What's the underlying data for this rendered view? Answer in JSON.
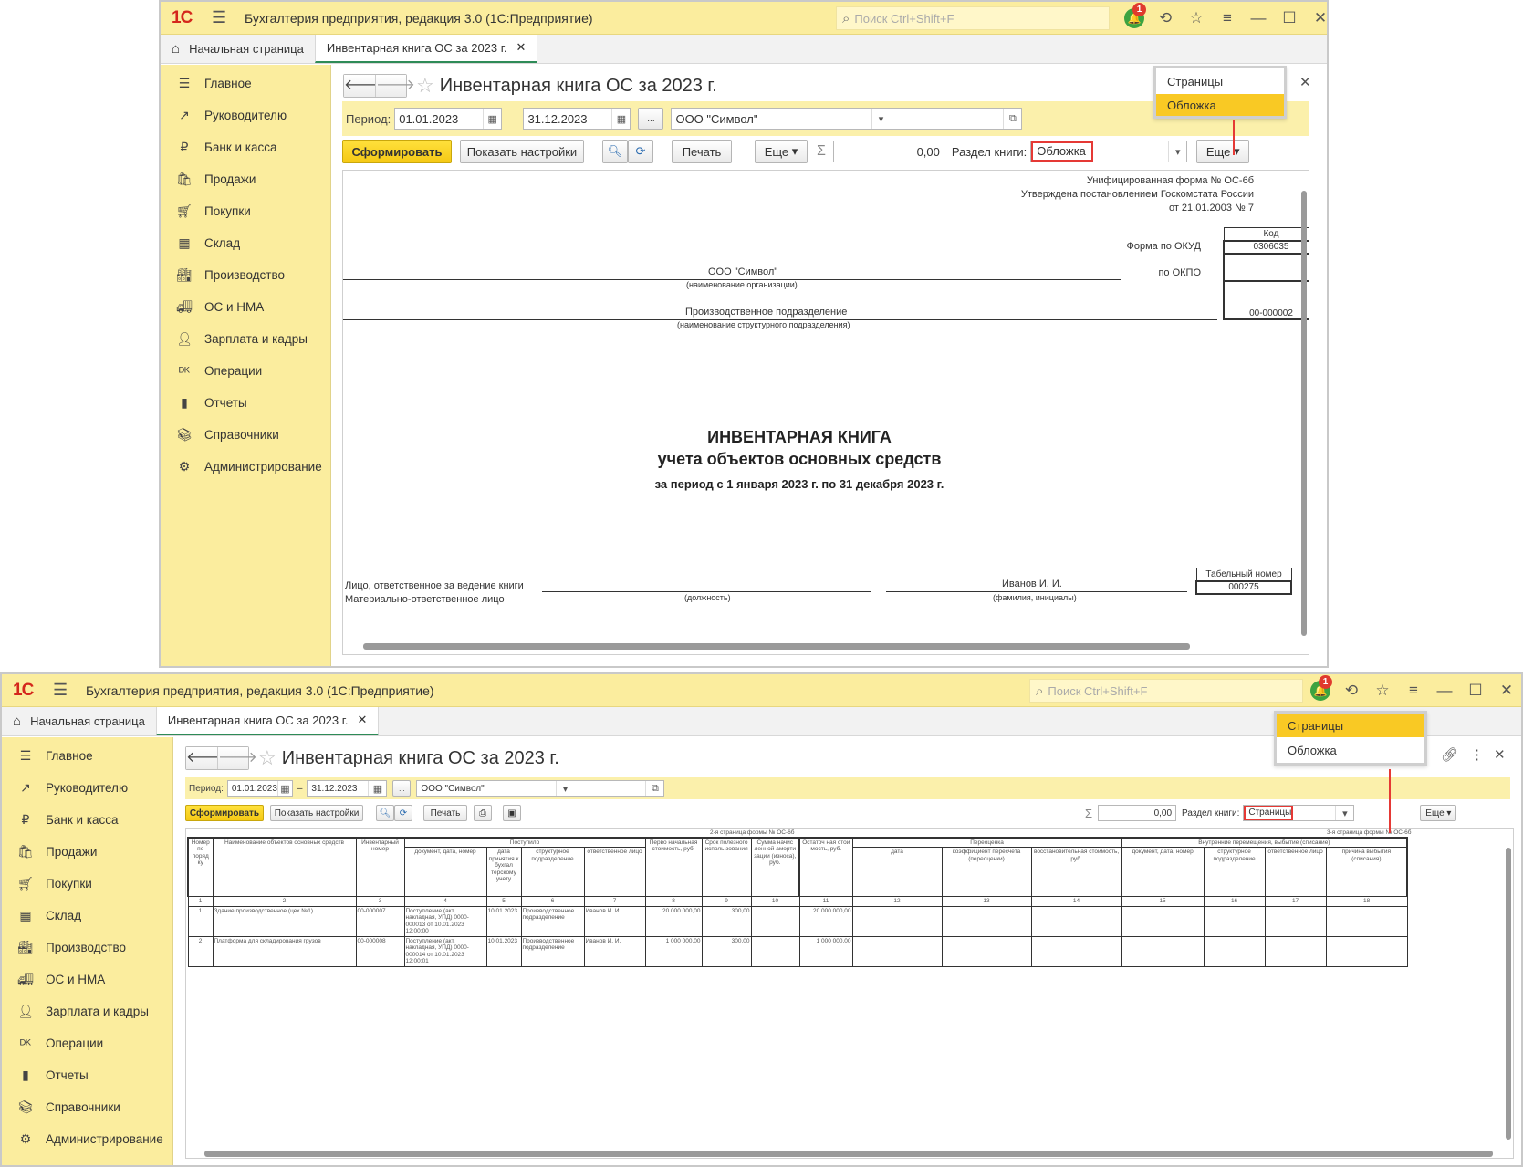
{
  "app": {
    "title": "Бухгалтерия предприятия, редакция 3.0  (1С:Предприятие)",
    "logo": "1С",
    "search_placeholder": "Поиск Ctrl+Shift+F",
    "notifications": "1"
  },
  "tabs": {
    "home": "Начальная страница",
    "active": "Инвентарная книга ОС за 2023 г."
  },
  "sidebar": {
    "items": [
      {
        "label": "Главное",
        "icon": "menu-lines-icon"
      },
      {
        "label": "Руководителю",
        "icon": "trend-icon"
      },
      {
        "label": "Банк и касса",
        "icon": "ruble-coin-icon"
      },
      {
        "label": "Продажи",
        "icon": "bag-icon"
      },
      {
        "label": "Покупки",
        "icon": "cart-icon"
      },
      {
        "label": "Склад",
        "icon": "grid-icon"
      },
      {
        "label": "Производство",
        "icon": "factory-icon"
      },
      {
        "label": "ОС и НМА",
        "icon": "truck-icon"
      },
      {
        "label": "Зарплата и кадры",
        "icon": "person-icon"
      },
      {
        "label": "Операции",
        "icon": "dt-kt-icon"
      },
      {
        "label": "Отчеты",
        "icon": "bars-icon"
      },
      {
        "label": "Справочники",
        "icon": "books-icon"
      },
      {
        "label": "Администрирование",
        "icon": "gear-icon"
      }
    ]
  },
  "report": {
    "title": "Инвентарная книга ОС за 2023 г.",
    "period_label": "Период:",
    "date_from": "01.01.2023",
    "dash": "–",
    "date_to": "31.12.2023",
    "ellipsis": "...",
    "organization": "ООО \"Символ\"",
    "generate": "Сформировать",
    "show_settings": "Показать настройки",
    "print": "Печать",
    "more": "Еще",
    "sigma_value": "0,00",
    "section_label": "Раздел книги:",
    "section_value_1": "Обложка",
    "section_value_2": "Страницы",
    "menu": [
      "Страницы",
      "Обложка"
    ]
  },
  "cover": {
    "form_line1": "Унифицированная форма № ОС-6б",
    "form_line2": "Утверждена постановлением Госкомстата России",
    "form_line3": "от 21.01.2003 № 7",
    "code_header": "Код",
    "okud_label": "Форма по ОКУД",
    "okud": "0306035",
    "okpo_label": "по ОКПО",
    "org": "ООО \"Символ\"",
    "org_caption": "(наименование организации)",
    "division": "Производственное подразделение",
    "division_caption": "(наименование структурного подразделения)",
    "division_code": "00-000002",
    "title1": "ИНВЕНТАРНАЯ КНИГА",
    "title2": "учета объектов основных средств",
    "period": "за период с 1 января 2023 г. по 31 декабря 2023 г.",
    "resp1": "Лицо, ответственное за ведение книги",
    "resp2": "Материально-ответственное лицо",
    "position_caption": "(должность)",
    "name": "Иванов И. И.",
    "name_caption": "(фамилия, инициалы)",
    "tab_no_label": "Табельный номер",
    "tab_no": "000275"
  },
  "pages": {
    "note2": "2-я страница формы № ОС-6б",
    "note3": "3-я страница формы № ОС-6б",
    "h": {
      "c1": "Номер по поряд ку",
      "c2": "Наименование объектов основных средств",
      "c3": "Инвентарный номер",
      "received": "Поступило",
      "c4": "документ, дата, номер",
      "c5": "дата принятия к бухгал терскому учету",
      "c6": "структурное подразделение",
      "c7": "ответственное лицо",
      "c8": "Перво начальная стоимость, руб.",
      "c9": "Срок полезного исполь зования",
      "c10": "Сумма начис ленной аморти зации (износа), руб.",
      "c11": "Остаточ ная стои мость, руб.",
      "reval": "Переоценка",
      "c12": "дата",
      "c13": "коэффициент пересчета (переоценки)",
      "c14": "восстановительная стоимость, руб.",
      "move": "Внутренние перемещения, выбытие (списание)",
      "c15": "документ, дата, номер",
      "c16": "структурное подразделение",
      "c17": "ответственное лицо",
      "c18": "причина выбытия (списания)"
    },
    "nums": [
      "1",
      "2",
      "3",
      "4",
      "5",
      "6",
      "7",
      "8",
      "9",
      "10",
      "11",
      "12",
      "13",
      "14",
      "15",
      "16",
      "17",
      "18"
    ],
    "rows": [
      {
        "n": "1",
        "name": "Здание производственное (цех №1)",
        "inv": "00-000007",
        "doc": "Поступление (акт, накладная, УПД) 0000-000013 от 10.01.2023 12:00:00",
        "date": "10.01.2023",
        "div": "Производственное подразделение",
        "person": "Иванов И. И.",
        "cost": "20 000 000,00",
        "term": "300,00",
        "amort": "",
        "rest": "20 000 000,00"
      },
      {
        "n": "2",
        "name": "Платформа для складирования грузов",
        "inv": "00-000008",
        "doc": "Поступление (акт, накладная, УПД) 0000-000014 от 10.01.2023 12:00:01",
        "date": "10.01.2023",
        "div": "Производственное подразделение",
        "person": "Иванов И. И.",
        "cost": "1 000 000,00",
        "term": "300,00",
        "amort": "",
        "rest": "1 000 000,00"
      }
    ]
  }
}
